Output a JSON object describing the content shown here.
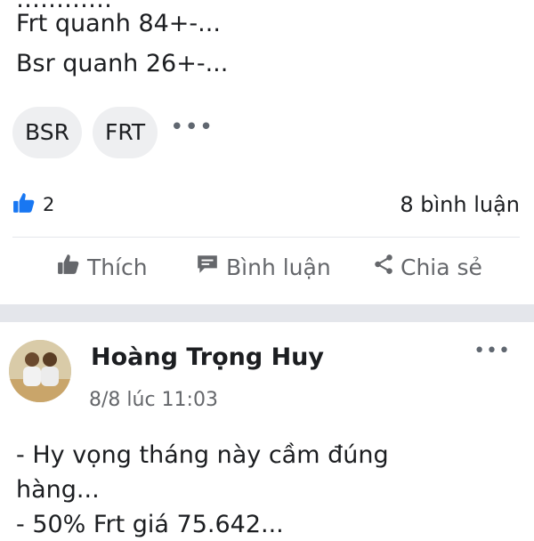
{
  "post1": {
    "lines": [
      "Frt quanh 84+-...",
      "Bsr quanh 26+-..."
    ],
    "tags": [
      "BSR",
      "FRT"
    ],
    "more_tags_icon": "more-horizontal-icon",
    "like_count": "2",
    "comment_count": "8 bình luận"
  },
  "actions": {
    "like": "Thích",
    "comment": "Bình luận",
    "share": "Chia sẻ"
  },
  "post2": {
    "author": "Hoàng Trọng Huy",
    "timestamp": "8/8 lúc 11:03",
    "lines": [
      "- Hy vọng tháng này cầm đúng",
      "hàng...",
      "- 50% Frt giá 75.642..."
    ]
  },
  "colors": {
    "like_blue": "#1877f2",
    "muted": "#65676b",
    "separator": "#e4e6eb"
  }
}
